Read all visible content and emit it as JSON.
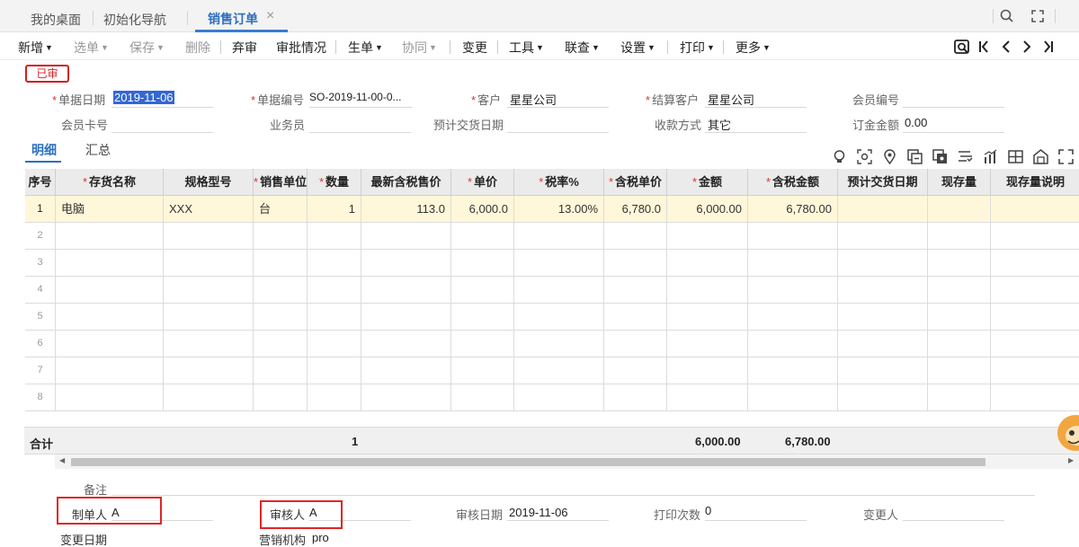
{
  "tabs": [
    {
      "label": "我的桌面"
    },
    {
      "label": "初始化导航"
    },
    {
      "label": "销售订单",
      "active": true
    }
  ],
  "tab_close_glyph": "×",
  "top_icons": [
    "search-icon",
    "expand-icon"
  ],
  "toolbar": {
    "items": [
      {
        "label": "新增",
        "dropdown": true,
        "disabled": false
      },
      {
        "label": "选单",
        "dropdown": true,
        "disabled": true
      },
      {
        "label": "保存",
        "dropdown": true,
        "disabled": true
      },
      {
        "label": "删除",
        "dropdown": false,
        "disabled": true
      },
      {
        "label": "弃审",
        "dropdown": false,
        "disabled": false
      },
      {
        "label": "审批情况",
        "dropdown": false,
        "disabled": false
      },
      {
        "label": "生单",
        "dropdown": true,
        "disabled": false
      },
      {
        "label": "协同",
        "dropdown": true,
        "disabled": true
      },
      {
        "label": "变更",
        "dropdown": false,
        "disabled": false
      },
      {
        "label": "工具",
        "dropdown": true,
        "disabled": false
      },
      {
        "label": "联查",
        "dropdown": true,
        "disabled": false
      },
      {
        "label": "设置",
        "dropdown": true,
        "disabled": false
      },
      {
        "label": "打印",
        "dropdown": true,
        "disabled": false
      },
      {
        "label": "更多",
        "dropdown": true,
        "disabled": false
      }
    ],
    "nav_icons": [
      "locate-icon",
      "first-record-icon",
      "previous-record-icon",
      "next-record-icon",
      "last-record-icon"
    ]
  },
  "status_stamp": "已审",
  "header_fields": {
    "date": {
      "label": "单据日期",
      "value": "2019-11-06",
      "required": true
    },
    "code": {
      "label": "单据编号",
      "value": "SO-2019-11-00-0...",
      "required": true
    },
    "customer": {
      "label": "客户",
      "value": "星星公司",
      "required": true
    },
    "settle_customer": {
      "label": "结算客户",
      "value": "星星公司",
      "required": true
    },
    "member_no": {
      "label": "会员编号",
      "value": ""
    },
    "member_card": {
      "label": "会员卡号",
      "value": ""
    },
    "salesman": {
      "label": "业务员",
      "value": ""
    },
    "expected_delivery": {
      "label": "预计交货日期",
      "value": ""
    },
    "payment_method": {
      "label": "收款方式",
      "value": "其它"
    },
    "deposit": {
      "label": "订金金额",
      "value": "0.00"
    }
  },
  "detail_tabs": [
    {
      "label": "明细",
      "active": true
    },
    {
      "label": "汇总"
    }
  ],
  "grid_tool_icons": [
    "bulb-icon",
    "scan-icon",
    "location-pin-icon",
    "copy-row-icon",
    "batch-icon",
    "filter-icon",
    "chart-icon",
    "split-icon",
    "warehouse-icon",
    "fullscreen-icon"
  ],
  "grid": {
    "columns": [
      {
        "label": "序号",
        "required": false
      },
      {
        "label": "存货名称",
        "required": true
      },
      {
        "label": "规格型号",
        "required": false
      },
      {
        "label": "销售单位",
        "required": true
      },
      {
        "label": "数量",
        "required": true
      },
      {
        "label": "最新含税售价",
        "required": false
      },
      {
        "label": "单价",
        "required": true
      },
      {
        "label": "税率%",
        "required": true
      },
      {
        "label": "含税单价",
        "required": true
      },
      {
        "label": "金额",
        "required": true
      },
      {
        "label": "含税金额",
        "required": true
      },
      {
        "label": "预计交货日期",
        "required": false
      },
      {
        "label": "现存量",
        "required": false
      },
      {
        "label": "现存量说明",
        "required": false
      }
    ],
    "rows": [
      [
        "1",
        "电脑",
        "XXX",
        "台",
        "1",
        "113.0",
        "6,000.0",
        "13.00%",
        "6,780.0",
        "6,000.00",
        "6,780.00",
        "",
        "",
        ""
      ],
      [
        "2",
        "",
        "",
        "",
        "",
        "",
        "",
        "",
        "",
        "",
        "",
        "",
        "",
        ""
      ],
      [
        "3",
        "",
        "",
        "",
        "",
        "",
        "",
        "",
        "",
        "",
        "",
        "",
        "",
        ""
      ],
      [
        "4",
        "",
        "",
        "",
        "",
        "",
        "",
        "",
        "",
        "",
        "",
        "",
        "",
        ""
      ],
      [
        "5",
        "",
        "",
        "",
        "",
        "",
        "",
        "",
        "",
        "",
        "",
        "",
        "",
        ""
      ],
      [
        "6",
        "",
        "",
        "",
        "",
        "",
        "",
        "",
        "",
        "",
        "",
        "",
        "",
        ""
      ],
      [
        "7",
        "",
        "",
        "",
        "",
        "",
        "",
        "",
        "",
        "",
        "",
        "",
        "",
        ""
      ],
      [
        "8",
        "",
        "",
        "",
        "",
        "",
        "",
        "",
        "",
        "",
        "",
        "",
        "",
        ""
      ]
    ]
  },
  "totals": {
    "label": "合计",
    "quantity": "1",
    "amount": "6,000.00",
    "amount_with_tax": "6,780.00"
  },
  "footer_fields": {
    "remark": {
      "label": "备注",
      "value": ""
    },
    "maker": {
      "label": "制单人",
      "value": "A"
    },
    "auditor": {
      "label": "审核人",
      "value": "A"
    },
    "audit_date": {
      "label": "审核日期",
      "value": "2019-11-06"
    },
    "print_count": {
      "label": "打印次数",
      "value": "0"
    },
    "changer": {
      "label": "变更人",
      "value": ""
    },
    "change_date": {
      "label": "变更日期",
      "value": ""
    },
    "marketing_org": {
      "label": "营销机构",
      "value": "pro"
    }
  },
  "colors": {
    "accent": "#2c6fc0",
    "stamp": "#d32020",
    "selected_row": "#fff7d9",
    "highlight_box": "#e02525"
  }
}
